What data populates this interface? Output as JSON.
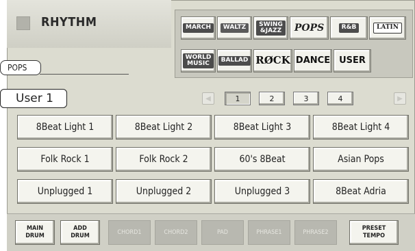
{
  "header": {
    "title": "RHYTHM"
  },
  "categories": [
    {
      "label": "MARCH",
      "style": "box"
    },
    {
      "label": "WALTZ",
      "style": "outline"
    },
    {
      "label": "SWING\n&JAZZ",
      "style": "box"
    },
    {
      "label": "POPS",
      "style": "italic"
    },
    {
      "label": "R&B",
      "style": "box"
    },
    {
      "label": "LATIN",
      "style": "latin"
    },
    {
      "label": "WORLD\nMUSIC",
      "style": "box"
    },
    {
      "label": "BALLAD",
      "style": "box"
    },
    {
      "label": "RØCK",
      "style": "rock"
    },
    {
      "label": "DANCE",
      "style": "plain"
    },
    {
      "label": "USER",
      "style": "plain"
    }
  ],
  "selected_category": "POPS",
  "group": {
    "label": "User 1"
  },
  "pages": [
    {
      "label": "1",
      "active": true
    },
    {
      "label": "2"
    },
    {
      "label": "3"
    },
    {
      "label": "4"
    }
  ],
  "nav": {
    "prev_glyph": "◀",
    "next_glyph": "▶"
  },
  "patterns": [
    [
      "8Beat Light 1",
      "8Beat Light 2",
      "8Beat Light 3",
      "8Beat Light 4"
    ],
    [
      "Folk Rock 1",
      "Folk Rock 2",
      "60's 8Beat",
      "Asian Pops"
    ],
    [
      "Unplugged 1",
      "Unplugged 2",
      "Unplugged 3",
      "8Beat Adria"
    ]
  ],
  "parts": [
    {
      "label": "MAIN\nDRUM",
      "enabled": true
    },
    {
      "label": "ADD\nDRUM",
      "enabled": true
    },
    {
      "label": "CHORD1",
      "enabled": false
    },
    {
      "label": "CHORD2",
      "enabled": false
    },
    {
      "label": "PAD",
      "enabled": false
    },
    {
      "label": "PHRASE1",
      "enabled": false
    },
    {
      "label": "PHRASE2",
      "enabled": false
    },
    {
      "label": "PRESET\nTEMPO",
      "enabled": true
    }
  ]
}
